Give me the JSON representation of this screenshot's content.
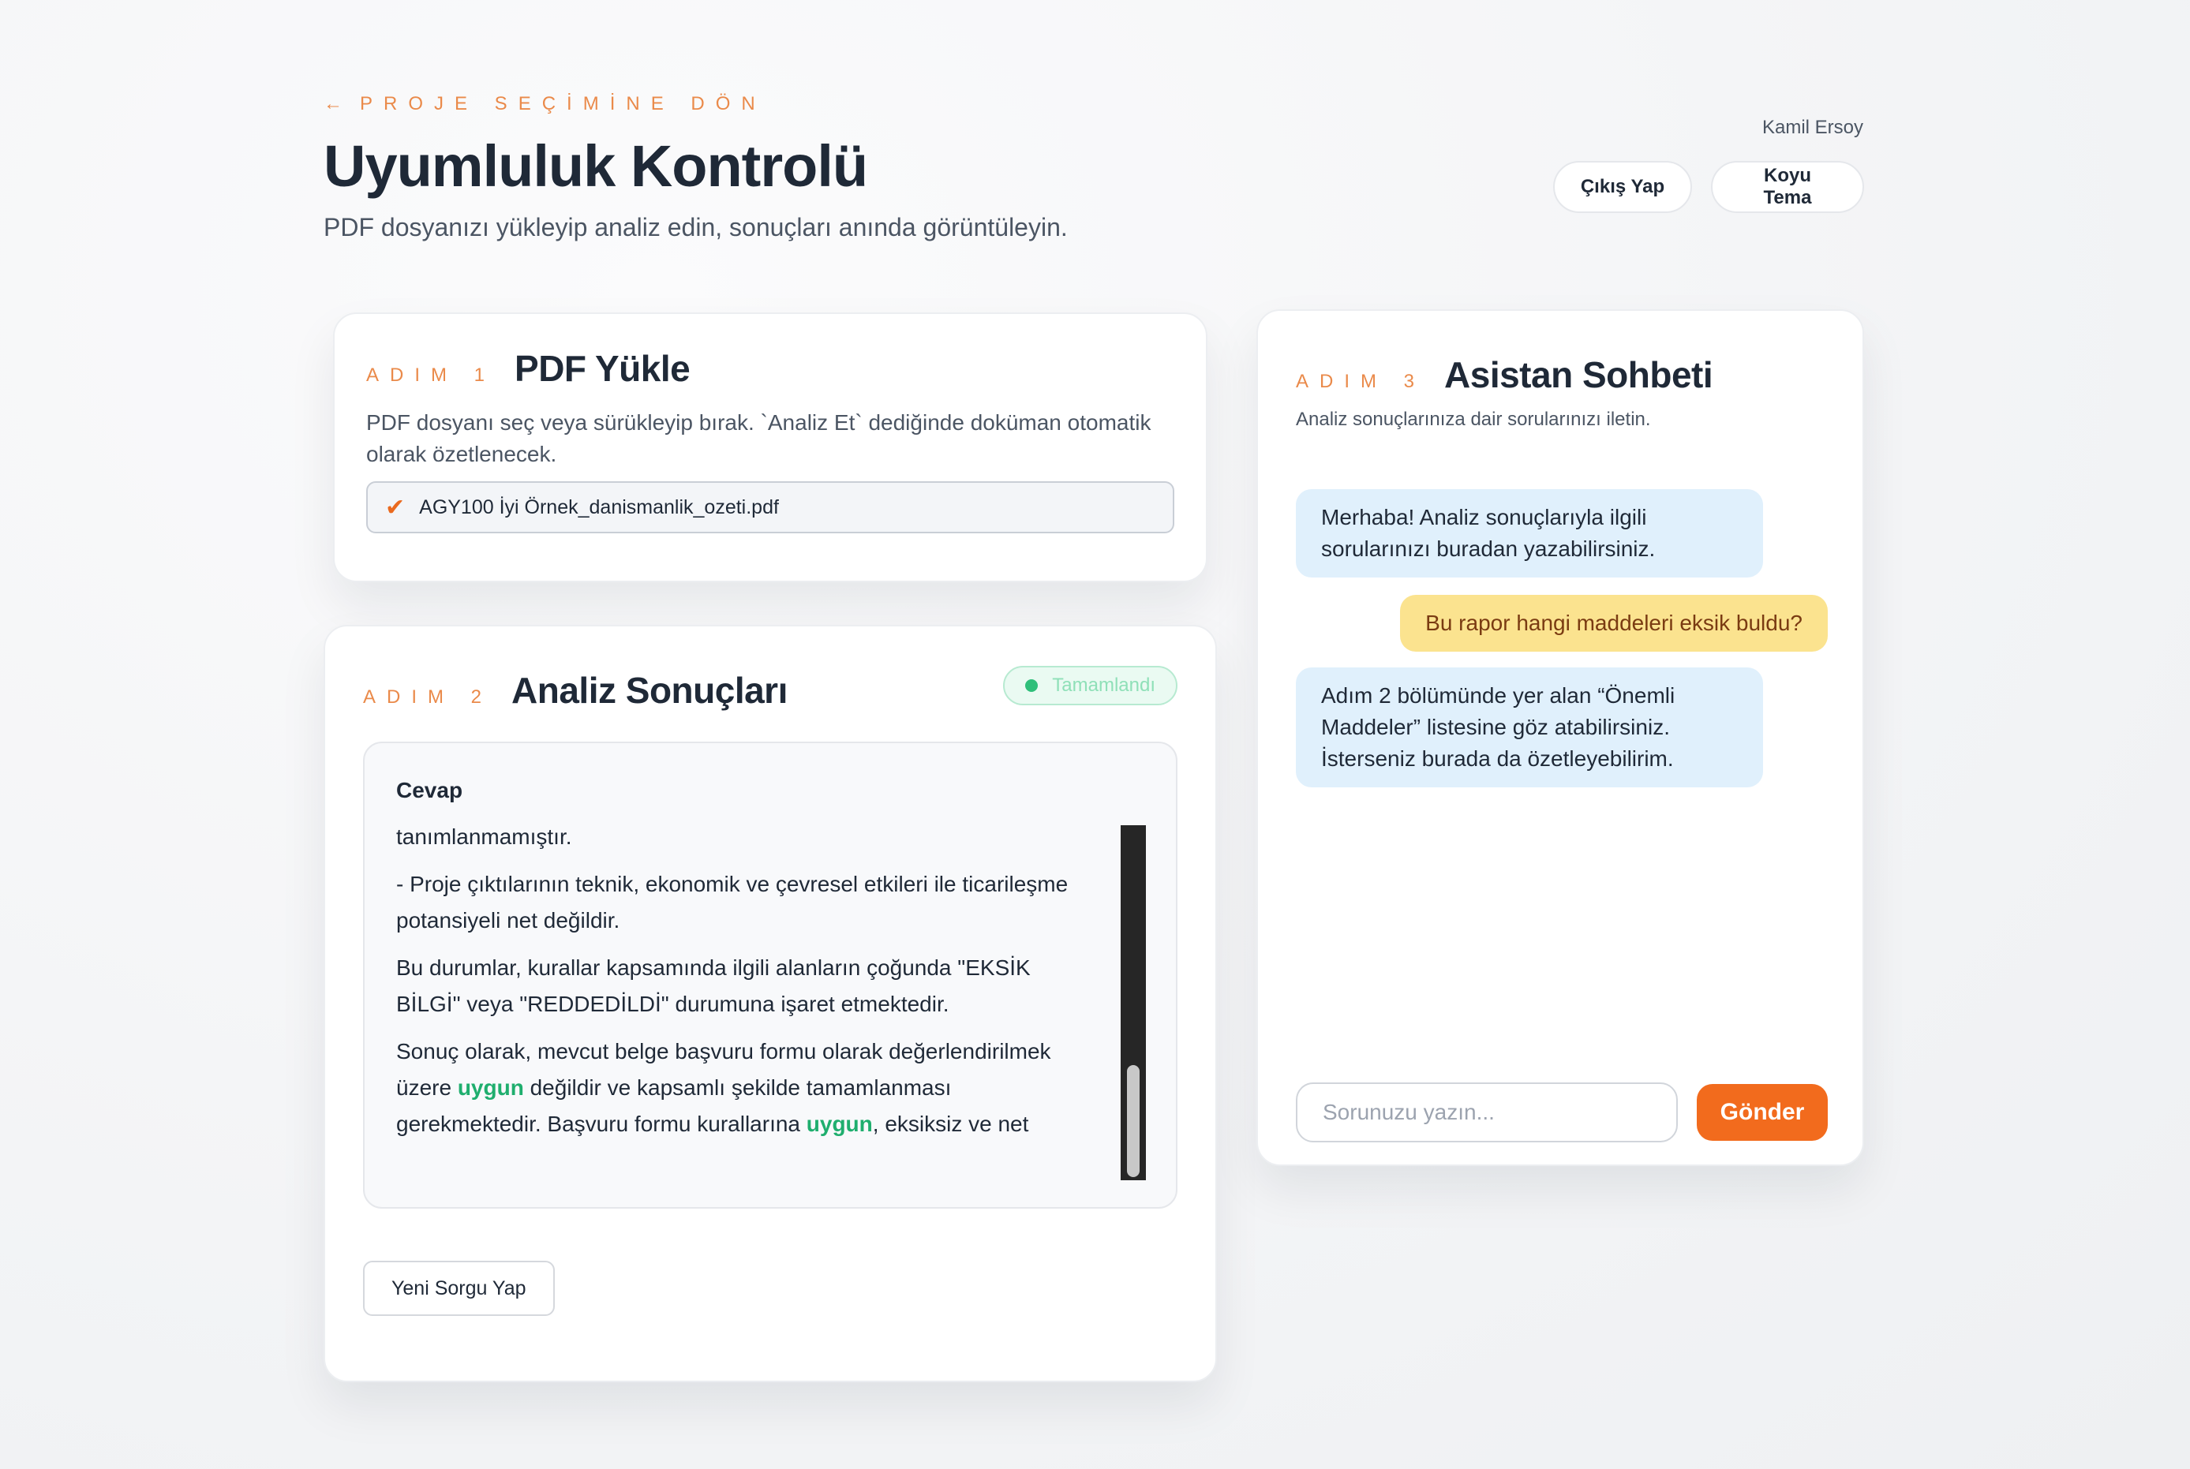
{
  "header": {
    "back_arrow": "←",
    "back_label": "PROJE SEÇİMİNE DÖN",
    "title": "Uyumluluk Kontrolü",
    "subtitle": "PDF dosyanızı yükleyip analiz edin, sonuçları anında görüntüleyin.",
    "user_name": "Kamil Ersoy",
    "logout_label": "Çıkış Yap",
    "theme_label": "Koyu Tema"
  },
  "upload": {
    "step": "ADIM 1",
    "title": "PDF Yükle",
    "description": "PDF dosyanı seç veya sürükleyip bırak. `Analiz Et` dediğinde doküman otomatik olarak özetlenecek.",
    "check_icon": "✔",
    "file_name": "AGY100 İyi Örnek_danismanlik_ozeti.pdf"
  },
  "results": {
    "step": "ADIM 2",
    "title": "Analiz Sonuçları",
    "status": "Tamamlandı",
    "answer_heading": "Cevap",
    "p1": "tanımlanmamıştır.",
    "p2": "- Proje çıktılarının teknik, ekonomik ve çevresel etkileri ile ticarileşme potansiyeli net değildir.",
    "p3": "Bu durumlar, kurallar kapsamında ilgili alanların çoğunda \"EKSİK BİLGİ\" veya \"REDDEDİLDİ\" durumuna işaret etmektedir.",
    "p4_a": "Sonuç olarak, mevcut belge başvuru formu olarak değerlendirilmek üzere ",
    "p4_hl1": "uygun",
    "p4_b": " değildir ve kapsamlı şekilde tamamlanması gerekmektedir. Başvuru formu kurallarına ",
    "p4_hl2": "uygun",
    "p4_c": ", eksiksiz ve net bilgilerle yeniden hazırlanmalıdır.",
    "new_query_label": "Yeni Sorgu Yap",
    "colors": {
      "highlight": "#1fae6e",
      "status": "#2fbf7a"
    }
  },
  "chat": {
    "step": "ADIM 3",
    "title": "Asistan Sohbeti",
    "description": "Analiz sonuçlarınıza dair sorularınızı iletin.",
    "messages": [
      {
        "role": "assistant",
        "text": "Merhaba! Analiz sonuçlarıyla ilgili sorularınızı buradan yazabilirsiniz."
      },
      {
        "role": "user",
        "text": "Bu rapor hangi maddeleri eksik buldu?"
      },
      {
        "role": "assistant",
        "text": "Adım 2 bölümünde yer alan “Önemli Maddeler” listesine göz atabilirsiniz. İsterseniz burada da özetleyebilirim."
      }
    ],
    "input_placeholder": "Sorunuzu yazın...",
    "send_label": "Gönder"
  },
  "colors": {
    "accent": "#f26b1d",
    "step_label": "#ea8a4a",
    "user_bubble": "#fbe38f",
    "bot_bubble": "#e0f0fc"
  }
}
